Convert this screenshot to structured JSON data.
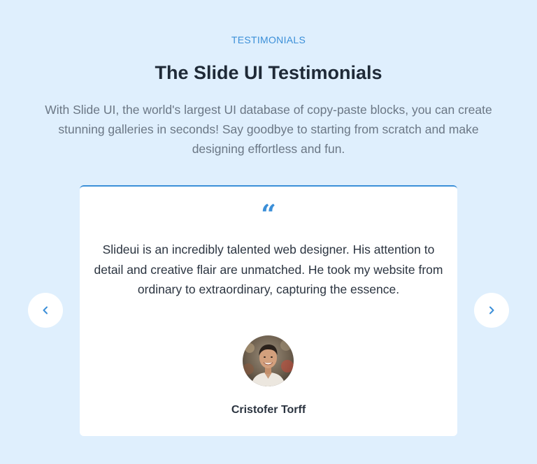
{
  "section": {
    "eyebrow": "TESTIMONIALS",
    "title": "The Slide UI Testimonials",
    "subtitle": "With Slide UI, the world's largest UI database of copy-paste blocks, you can create stunning galleries in seconds! Say goodbye to starting from scratch and make designing effortless and fun."
  },
  "testimonial": {
    "quote_mark": "“",
    "text": "Slideui is an incredibly talented web designer. His attention to detail and creative flair are unmatched. He took my website from ordinary to extraordinary, capturing the essence.",
    "author": "Cristofer Torff"
  },
  "navigation": {
    "prev_icon": "chevron-left-icon",
    "next_icon": "chevron-right-icon"
  },
  "colors": {
    "background": "#dfeffd",
    "accent": "#3b8fd8",
    "card": "#ffffff",
    "heading": "#1f2a37",
    "muted_text": "#6b7785"
  }
}
